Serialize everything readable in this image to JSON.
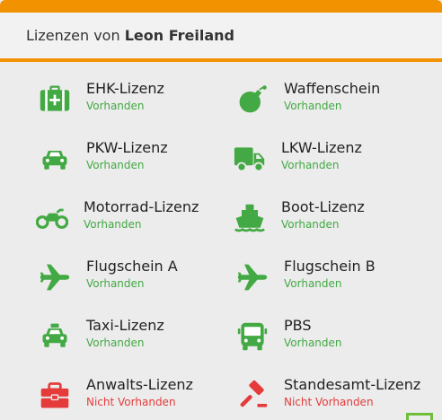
{
  "header": {
    "prefix": "Lizenzen von",
    "player": "Leon Freiland"
  },
  "colors": {
    "accent": "#f39200",
    "ok": "#43a944",
    "missing": "#e53b3b"
  },
  "licenses": [
    {
      "name": "EHK-Lizenz",
      "status": "Vorhanden",
      "icon": "first-aid-kit-icon",
      "owned": true
    },
    {
      "name": "Waffenschein",
      "status": "Vorhanden",
      "icon": "bomb-icon",
      "owned": true
    },
    {
      "name": "PKW-Lizenz",
      "status": "Vorhanden",
      "icon": "car-icon",
      "owned": true
    },
    {
      "name": "LKW-Lizenz",
      "status": "Vorhanden",
      "icon": "truck-icon",
      "owned": true
    },
    {
      "name": "Motorrad-Lizenz",
      "status": "Vorhanden",
      "icon": "motorcycle-icon",
      "owned": true
    },
    {
      "name": "Boot-Lizenz",
      "status": "Vorhanden",
      "icon": "ship-icon",
      "owned": true
    },
    {
      "name": "Flugschein A",
      "status": "Vorhanden",
      "icon": "plane-icon",
      "owned": true
    },
    {
      "name": "Flugschein B",
      "status": "Vorhanden",
      "icon": "plane-icon",
      "owned": true
    },
    {
      "name": "Taxi-Lizenz",
      "status": "Vorhanden",
      "icon": "taxi-icon",
      "owned": true
    },
    {
      "name": "PBS",
      "status": "Vorhanden",
      "icon": "bus-icon",
      "owned": true
    },
    {
      "name": "Anwalts-Lizenz",
      "status": "Nicht Vorhanden",
      "icon": "briefcase-icon",
      "owned": false
    },
    {
      "name": "Standesamt-Lizenz",
      "status": "Nicht Vorhanden",
      "icon": "gavel-icon",
      "owned": false
    }
  ]
}
